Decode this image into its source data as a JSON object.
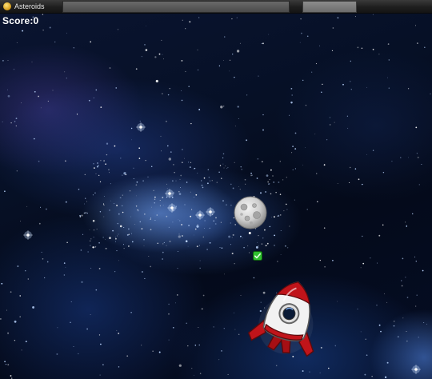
{
  "window": {
    "title": "Asteroids"
  },
  "hud": {
    "score_text": "Score:0"
  },
  "sprites": {
    "asteroid": "moon-asteroid",
    "bullet": "green-check-bullet",
    "ship": "red-white-rocket"
  },
  "colors": {
    "space_dark": "#040a1a",
    "nebula_blue": "#3c6ed2",
    "rocket_red": "#c0141a",
    "rocket_white": "#f2f2f2",
    "asteroid_gray": "#cfcfcf",
    "bullet_green": "#2fbf2f"
  }
}
